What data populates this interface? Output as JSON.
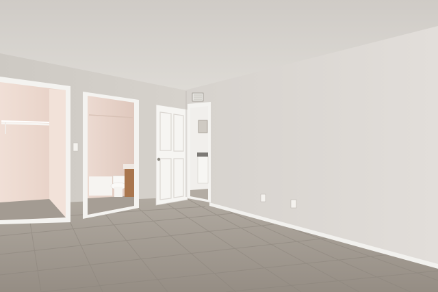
{
  "scene": {
    "description_colors": {
      "ceiling": "#d9d6d1",
      "wall_right": "#dcd8d3",
      "wall_left": "#d3cfc9",
      "floor": "#a49d94",
      "grout": "#8a837b",
      "baseboard": "#f2f1ee",
      "door": "#f6f5f2",
      "closet_interior": "#ecd9cf",
      "bathroom_interior": "#e8d6cc",
      "trim": "#f4f3f0"
    },
    "objects": [
      {
        "name": "ceiling"
      },
      {
        "name": "right-wall"
      },
      {
        "name": "left-wall"
      },
      {
        "name": "tile-floor"
      },
      {
        "name": "closet-opening"
      },
      {
        "name": "bathroom-doorway"
      },
      {
        "name": "open-panel-door"
      },
      {
        "name": "kitchen-doorway"
      },
      {
        "name": "air-vent"
      },
      {
        "name": "electrical-outlet"
      },
      {
        "name": "light-switch"
      },
      {
        "name": "toilet"
      },
      {
        "name": "bathtub"
      },
      {
        "name": "vanity-cabinet"
      },
      {
        "name": "closet-rod"
      }
    ]
  }
}
